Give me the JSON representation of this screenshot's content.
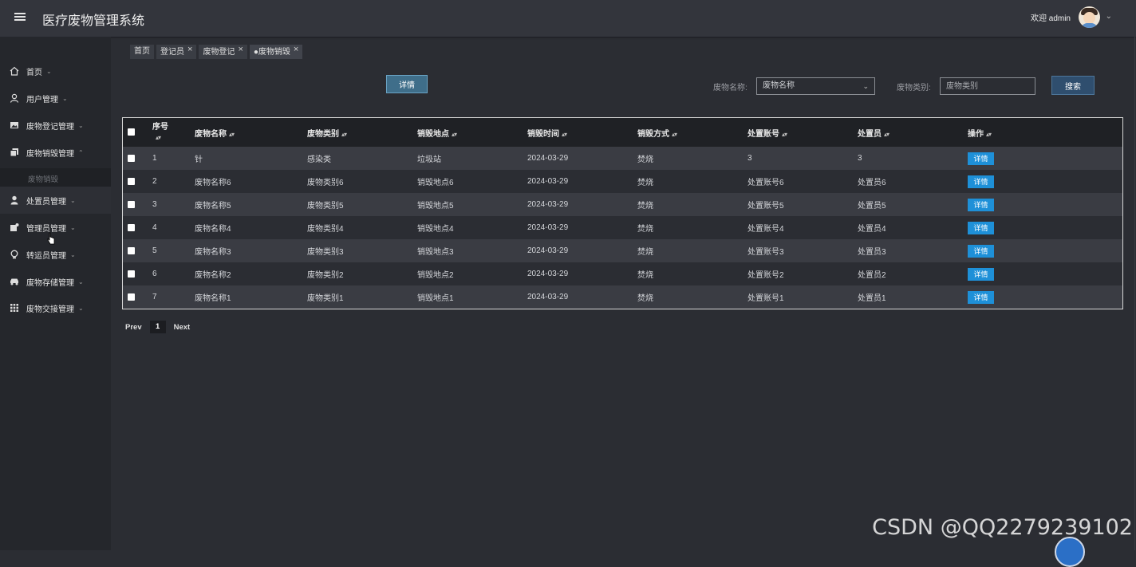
{
  "header": {
    "title": "医疗废物管理系统",
    "welcome": "欢迎 admin"
  },
  "sidebar": {
    "items": [
      {
        "label": "首页",
        "icon": "home-icon",
        "chevron": "⌄"
      },
      {
        "label": "用户管理",
        "icon": "user-icon",
        "chevron": "⌄"
      },
      {
        "label": "废物登记管理",
        "icon": "image-icon",
        "chevron": "⌄"
      },
      {
        "label": "废物销毁管理",
        "icon": "copy-icon",
        "chevron": "⌃"
      },
      {
        "label": "处置员管理",
        "icon": "person-icon",
        "chevron": "⌄"
      },
      {
        "label": "管理员管理",
        "icon": "puzzle-icon",
        "chevron": "⌄"
      },
      {
        "label": "转运员管理",
        "icon": "bulb-icon",
        "chevron": "⌄"
      },
      {
        "label": "废物存储管理",
        "icon": "car-icon",
        "chevron": "⌄"
      },
      {
        "label": "废物交接管理",
        "icon": "grid-icon",
        "chevron": "⌄"
      }
    ],
    "sub_item": "废物销毁"
  },
  "tabs": [
    {
      "label": "首页",
      "closable": false
    },
    {
      "label": "登记员",
      "closable": true
    },
    {
      "label": "废物登记",
      "closable": true
    },
    {
      "label": "●废物销毁",
      "closable": true
    }
  ],
  "toolbar": {
    "detail_label": "详情",
    "name_label": "废物名称:",
    "name_select_value": "废物名称",
    "type_label": "废物类别:",
    "type_placeholder": "废物类别",
    "search_label": "搜索"
  },
  "table": {
    "headers": [
      "序号",
      "废物名称",
      "废物类别",
      "销毁地点",
      "销毁时间",
      "销毁方式",
      "处置账号",
      "处置员",
      "操作"
    ],
    "detail_label": "详情",
    "rows": [
      [
        "1",
        "针",
        "感染类",
        "垃圾站",
        "2024-03-29",
        "焚烧",
        "3",
        "3"
      ],
      [
        "2",
        "废物名称6",
        "废物类别6",
        "销毁地点6",
        "2024-03-29",
        "焚烧",
        "处置账号6",
        "处置员6"
      ],
      [
        "3",
        "废物名称5",
        "废物类别5",
        "销毁地点5",
        "2024-03-29",
        "焚烧",
        "处置账号5",
        "处置员5"
      ],
      [
        "4",
        "废物名称4",
        "废物类别4",
        "销毁地点4",
        "2024-03-29",
        "焚烧",
        "处置账号4",
        "处置员4"
      ],
      [
        "5",
        "废物名称3",
        "废物类别3",
        "销毁地点3",
        "2024-03-29",
        "焚烧",
        "处置账号3",
        "处置员3"
      ],
      [
        "6",
        "废物名称2",
        "废物类别2",
        "销毁地点2",
        "2024-03-29",
        "焚烧",
        "处置账号2",
        "处置员2"
      ],
      [
        "7",
        "废物名称1",
        "废物类别1",
        "销毁地点1",
        "2024-03-29",
        "焚烧",
        "处置账号1",
        "处置员1"
      ]
    ]
  },
  "pager": {
    "prev": "Prev",
    "page": "1",
    "next": "Next"
  },
  "watermark": "CSDN @QQ2279239102",
  "colors": {
    "accent": "#1e90d8",
    "background": "#2b2d33",
    "sidebar": "#25272c"
  }
}
